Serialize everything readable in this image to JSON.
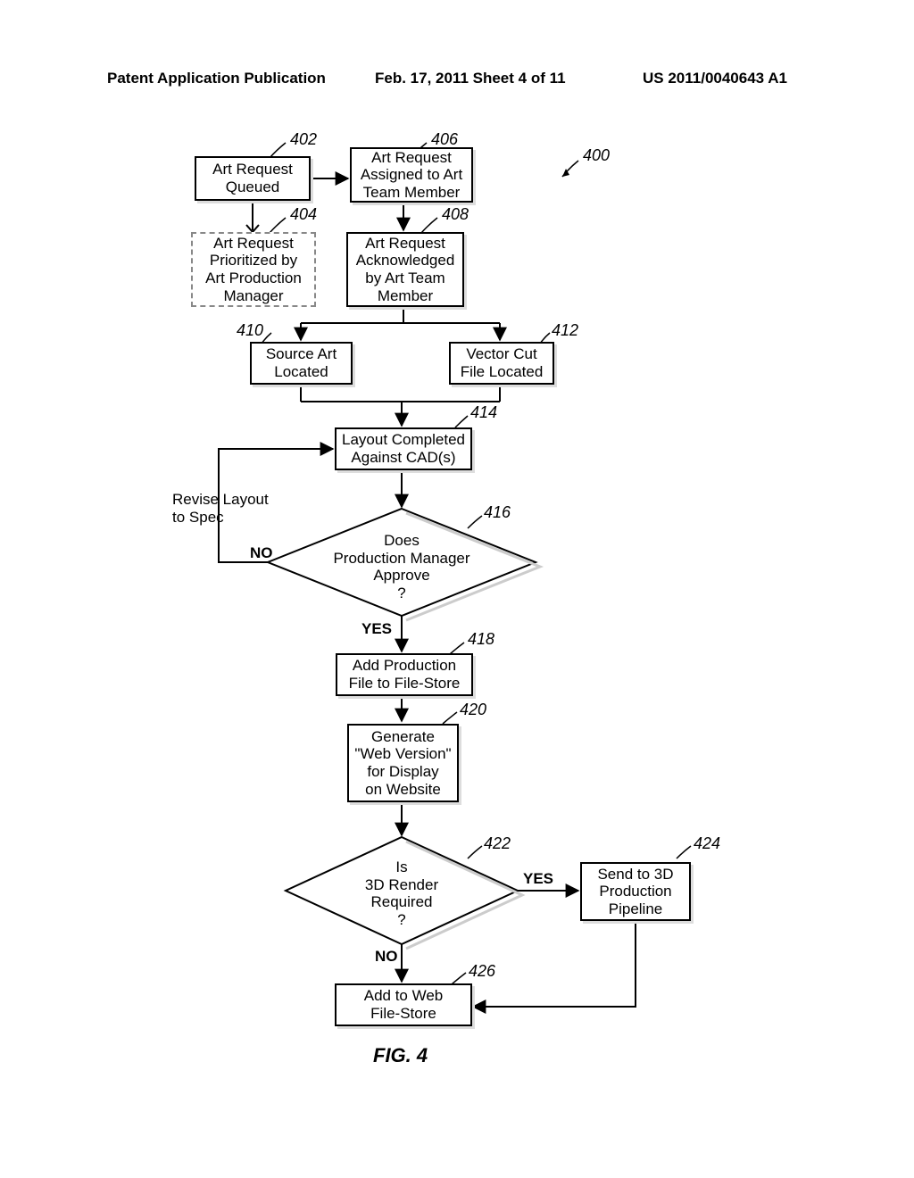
{
  "header": {
    "left": "Patent Application Publication",
    "center": "Feb. 17, 2011  Sheet 4 of 11",
    "right": "US 2011/0040643 A1"
  },
  "refs": {
    "r400": "400",
    "r402": "402",
    "r404": "404",
    "r406": "406",
    "r408": "408",
    "r410": "410",
    "r412": "412",
    "r414": "414",
    "r416": "416",
    "r418": "418",
    "r420": "420",
    "r422": "422",
    "r424": "424",
    "r426": "426"
  },
  "nodes": {
    "n402": "Art Request\nQueued",
    "n404": "Art Request\nPrioritized by\nArt Production\nManager",
    "n406": "Art Request\nAssigned to Art\nTeam Member",
    "n408": "Art Request\nAcknowledged\nby Art Team\nMember",
    "n410": "Source Art\nLocated",
    "n412": "Vector Cut\nFile Located",
    "n414": "Layout Completed\nAgainst CAD(s)",
    "n416": "Does\nProduction Manager\nApprove\n?",
    "n418": "Add Production\nFile to File-Store",
    "n420": "Generate\n\"Web Version\"\nfor Display\non Website",
    "n422": "Is\n3D Render\nRequired\n?",
    "n424": "Send to 3D\nProduction\nPipeline",
    "n426": "Add to Web\nFile-Store"
  },
  "labels": {
    "revise": "Revise Layout\nto Spec",
    "no": "NO",
    "yes": "YES",
    "yes2": "YES",
    "no2": "NO"
  },
  "caption": "FIG. 4",
  "chart_data": {
    "type": "flowchart",
    "title": "FIG. 4",
    "reference_numeral": "400",
    "nodes": [
      {
        "id": "402",
        "label": "Art Request Queued",
        "shape": "process"
      },
      {
        "id": "404",
        "label": "Art Request Prioritized by Art Production Manager",
        "shape": "process-dashed"
      },
      {
        "id": "406",
        "label": "Art Request Assigned to Art Team Member",
        "shape": "process"
      },
      {
        "id": "408",
        "label": "Art Request Acknowledged by Art Team Member",
        "shape": "process"
      },
      {
        "id": "410",
        "label": "Source Art Located",
        "shape": "process"
      },
      {
        "id": "412",
        "label": "Vector Cut File Located",
        "shape": "process"
      },
      {
        "id": "414",
        "label": "Layout Completed Against CAD(s)",
        "shape": "process"
      },
      {
        "id": "416",
        "label": "Does Production Manager Approve ?",
        "shape": "decision"
      },
      {
        "id": "418",
        "label": "Add Production File to File-Store",
        "shape": "process"
      },
      {
        "id": "420",
        "label": "Generate \"Web Version\" for Display on Website",
        "shape": "process"
      },
      {
        "id": "422",
        "label": "Is 3D Render Required ?",
        "shape": "decision"
      },
      {
        "id": "424",
        "label": "Send to 3D Production Pipeline",
        "shape": "process"
      },
      {
        "id": "426",
        "label": "Add to Web File-Store",
        "shape": "process"
      }
    ],
    "edges": [
      {
        "from": "402",
        "to": "406"
      },
      {
        "from": "402",
        "to": "404"
      },
      {
        "from": "406",
        "to": "408"
      },
      {
        "from": "408",
        "to": "410"
      },
      {
        "from": "408",
        "to": "412"
      },
      {
        "from": "410",
        "to": "414"
      },
      {
        "from": "412",
        "to": "414"
      },
      {
        "from": "414",
        "to": "416"
      },
      {
        "from": "416",
        "to": "414",
        "label": "NO",
        "note": "Revise Layout to Spec"
      },
      {
        "from": "416",
        "to": "418",
        "label": "YES"
      },
      {
        "from": "418",
        "to": "420"
      },
      {
        "from": "420",
        "to": "422"
      },
      {
        "from": "422",
        "to": "424",
        "label": "YES"
      },
      {
        "from": "422",
        "to": "426",
        "label": "NO"
      },
      {
        "from": "424",
        "to": "426"
      }
    ]
  }
}
